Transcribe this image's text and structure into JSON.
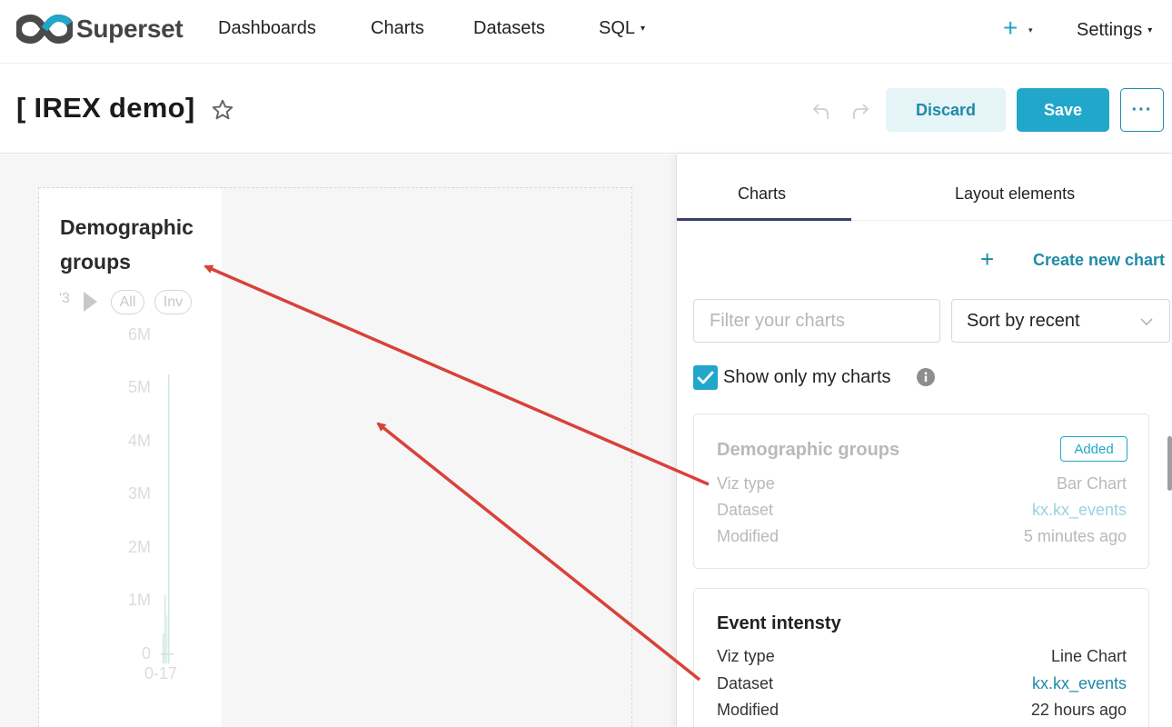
{
  "app": {
    "brand": "Superset",
    "nav": {
      "dashboards": "Dashboards",
      "charts": "Charts",
      "datasets": "Datasets",
      "sql": "SQL",
      "plus": "+",
      "settings": "Settings"
    }
  },
  "header": {
    "title": "[ IREX demo]",
    "discard": "Discard",
    "save": "Save",
    "more": "···"
  },
  "canvas_chart": {
    "title": "Demographic groups",
    "legend_fragment": "'3",
    "legend_pills": [
      "All",
      "Inv"
    ],
    "y_ticks": [
      "6M",
      "5M",
      "4M",
      "3M",
      "2M",
      "1M",
      "0"
    ],
    "x_tick": "0-17"
  },
  "panel": {
    "tabs": [
      "Charts",
      "Layout elements"
    ],
    "create_plus": "+",
    "create_label": "Create new chart",
    "filter_placeholder": "Filter your charts",
    "sort_value": "Sort by recent",
    "show_only_mine": "Show only my charts",
    "show_only_mine_checked": true,
    "cards": [
      {
        "title": "Demographic groups",
        "badge": "Added",
        "viz_label": "Viz type",
        "viz_value": "Bar Chart",
        "dataset_label": "Dataset",
        "dataset_value": "kx.kx_events",
        "modified_label": "Modified",
        "modified_value": "5 minutes ago"
      },
      {
        "title": "Event intensty",
        "viz_label": "Viz type",
        "viz_value": "Line Chart",
        "dataset_label": "Dataset",
        "dataset_value": "kx.kx_events",
        "modified_label": "Modified",
        "modified_value": "22 hours ago"
      }
    ]
  },
  "colors": {
    "primary": "#20a7c9",
    "primary_dark": "#1f8aa8",
    "annotation_arrow": "#d9413a"
  }
}
